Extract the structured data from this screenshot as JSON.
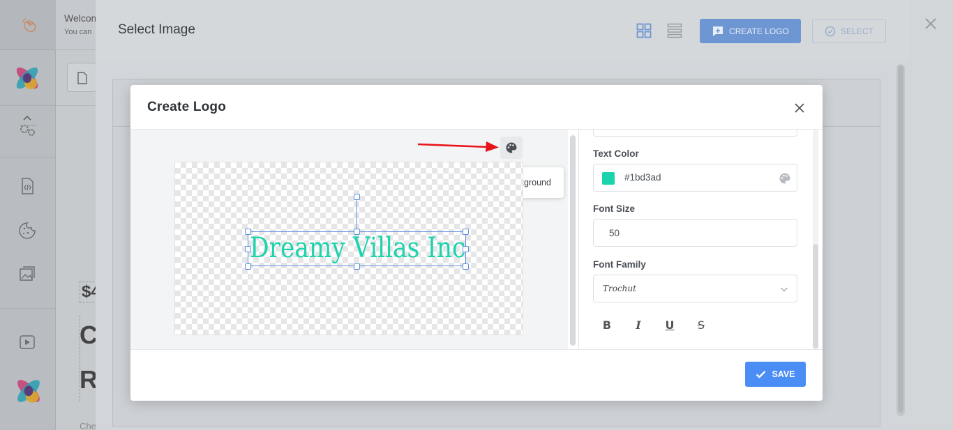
{
  "background_app": {
    "welcome_title": "Welcome",
    "welcome_sub": "You can",
    "price_partial": "$4",
    "big_text_1": "C",
    "big_text_2": "R",
    "small_text": "Che"
  },
  "select_dialog": {
    "title": "Select Image",
    "create_logo_label": "CREATE LOGO",
    "select_label": "SELECT"
  },
  "create_logo_modal": {
    "title": "Create Logo",
    "tooltip": "Change Preview Background",
    "logo_text": "Dreamy Villas Inc",
    "logo_color": "#1bd3ad",
    "save_label": "SAVE",
    "properties": {
      "text_color_label": "Text Color",
      "text_color_value": "#1bd3ad",
      "font_size_label": "Font Size",
      "font_size_value": "50",
      "font_family_label": "Font Family",
      "font_family_value": "Trochut",
      "format_buttons": [
        "B",
        "I",
        "U",
        "S"
      ]
    }
  },
  "colors": {
    "primary": "#4a8ef5",
    "selection": "#5b8fe0",
    "teal": "#1bd3ad",
    "arrow": "#e8141b"
  },
  "icons": [
    "wave-hand-icon",
    "brand-logo-icon",
    "chevron-up-icon",
    "settings-gears-icon",
    "code-file-icon",
    "cookie-icon",
    "images-icon",
    "play-icon",
    "grid-view-icon",
    "list-view-icon",
    "add-comment-icon",
    "check-circle-icon",
    "close-icon",
    "palette-icon",
    "checkmark-icon",
    "chevron-down-icon"
  ]
}
